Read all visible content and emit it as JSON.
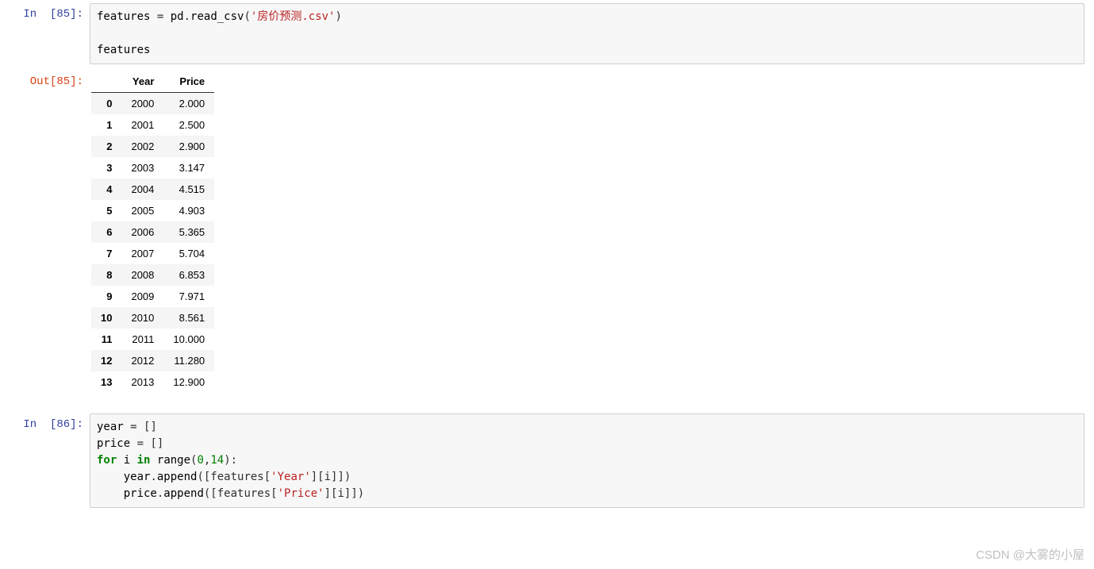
{
  "cells": {
    "c85": {
      "in_prompt": "In  [85]:",
      "code_tokens": [
        [
          "features ",
          "n"
        ],
        [
          "=",
          "o"
        ],
        [
          " pd",
          "n"
        ],
        [
          ".",
          "o"
        ],
        [
          "read_csv",
          "n"
        ],
        [
          "(",
          "o"
        ],
        [
          "'房价预测.csv'",
          "s"
        ],
        [
          ")",
          "o"
        ],
        [
          "\n\n",
          ""
        ],
        [
          "features",
          "n"
        ]
      ],
      "out_prompt": "Out[85]:",
      "table": {
        "columns": [
          "",
          "Year",
          "Price"
        ],
        "rows": [
          [
            "0",
            "2000",
            "2.000"
          ],
          [
            "1",
            "2001",
            "2.500"
          ],
          [
            "2",
            "2002",
            "2.900"
          ],
          [
            "3",
            "2003",
            "3.147"
          ],
          [
            "4",
            "2004",
            "4.515"
          ],
          [
            "5",
            "2005",
            "4.903"
          ],
          [
            "6",
            "2006",
            "5.365"
          ],
          [
            "7",
            "2007",
            "5.704"
          ],
          [
            "8",
            "2008",
            "6.853"
          ],
          [
            "9",
            "2009",
            "7.971"
          ],
          [
            "10",
            "2010",
            "8.561"
          ],
          [
            "11",
            "2011",
            "10.000"
          ],
          [
            "12",
            "2012",
            "11.280"
          ],
          [
            "13",
            "2013",
            "12.900"
          ]
        ]
      }
    },
    "c86": {
      "in_prompt": "In  [86]:",
      "code_tokens": [
        [
          "year ",
          "n"
        ],
        [
          "=",
          "o"
        ],
        [
          " []",
          "o"
        ],
        [
          "\n",
          ""
        ],
        [
          "price ",
          "n"
        ],
        [
          "=",
          "o"
        ],
        [
          " []",
          "o"
        ],
        [
          "\n",
          ""
        ],
        [
          "for",
          "k"
        ],
        [
          " i ",
          "n"
        ],
        [
          "in",
          "kn"
        ],
        [
          " ",
          ""
        ],
        [
          "range",
          "n"
        ],
        [
          "(",
          "o"
        ],
        [
          "0",
          "mi"
        ],
        [
          ",",
          "o"
        ],
        [
          "14",
          "mi"
        ],
        [
          "):",
          "o"
        ],
        [
          "\n",
          ""
        ],
        [
          "    year",
          "n"
        ],
        [
          ".",
          "o"
        ],
        [
          "append",
          "n"
        ],
        [
          "([features[",
          "o"
        ],
        [
          "'Year'",
          "s"
        ],
        [
          "][i]])",
          "o"
        ],
        [
          "\n",
          ""
        ],
        [
          "    price",
          "n"
        ],
        [
          ".",
          "o"
        ],
        [
          "append",
          "n"
        ],
        [
          "([features[",
          "o"
        ],
        [
          "'Price'",
          "s"
        ],
        [
          "][i]])",
          "o"
        ]
      ]
    }
  },
  "watermark": "CSDN @大雾的小屋",
  "chart_data": {
    "type": "table",
    "columns": [
      "Year",
      "Price"
    ],
    "rows": [
      [
        2000,
        2.0
      ],
      [
        2001,
        2.5
      ],
      [
        2002,
        2.9
      ],
      [
        2003,
        3.147
      ],
      [
        2004,
        4.515
      ],
      [
        2005,
        4.903
      ],
      [
        2006,
        5.365
      ],
      [
        2007,
        5.704
      ],
      [
        2008,
        6.853
      ],
      [
        2009,
        7.971
      ],
      [
        2010,
        8.561
      ],
      [
        2011,
        10.0
      ],
      [
        2012,
        11.28
      ],
      [
        2013,
        12.9
      ]
    ]
  }
}
